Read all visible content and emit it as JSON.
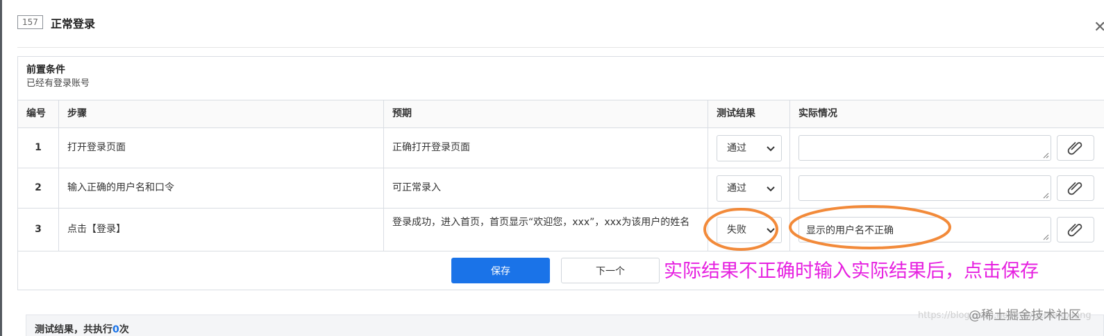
{
  "header": {
    "case_id": "157",
    "title": "正常登录",
    "close_glyph": "✕"
  },
  "precondition": {
    "title": "前置条件",
    "text": "已经有登录账号"
  },
  "table": {
    "columns": [
      "编号",
      "步骤",
      "预期",
      "测试结果",
      "实际情况"
    ],
    "rows": [
      {
        "num": "1",
        "step": "打开登录页面",
        "expected": "正确打开登录页面",
        "result": "通过",
        "actual": ""
      },
      {
        "num": "2",
        "step": "输入正确的用户名和口令",
        "expected": "可正常录入",
        "result": "通过",
        "actual": ""
      },
      {
        "num": "3",
        "step": "点击【登录】",
        "expected": "登录成功，进入首页，首页显示“欢迎您，xxx”，xxx为该用户的姓名",
        "result": "失败",
        "actual": "显示的用户名不正确"
      }
    ]
  },
  "actions": {
    "save_label": "保存",
    "next_label": "下一个"
  },
  "annotation": {
    "callout": "实际结果不正确时输入实际结果后，点击保存",
    "callout_color": "#e620e0",
    "circle_color": "#f28a3a"
  },
  "bottom": {
    "label_prefix": "测试结果，共执行",
    "count": "0",
    "label_suffix": "次"
  },
  "watermark": {
    "site": "https://blog.csdn.net/cuiyuchengxiong",
    "brand": "@稀土掘金技术社区"
  },
  "icons": {
    "close": "close-icon",
    "select": "chevron-down-icon",
    "attach": "paperclip-icon",
    "resize": "resize-grip-icon"
  },
  "colors": {
    "primary": "#1a73e8",
    "border": "#d9dde3"
  }
}
